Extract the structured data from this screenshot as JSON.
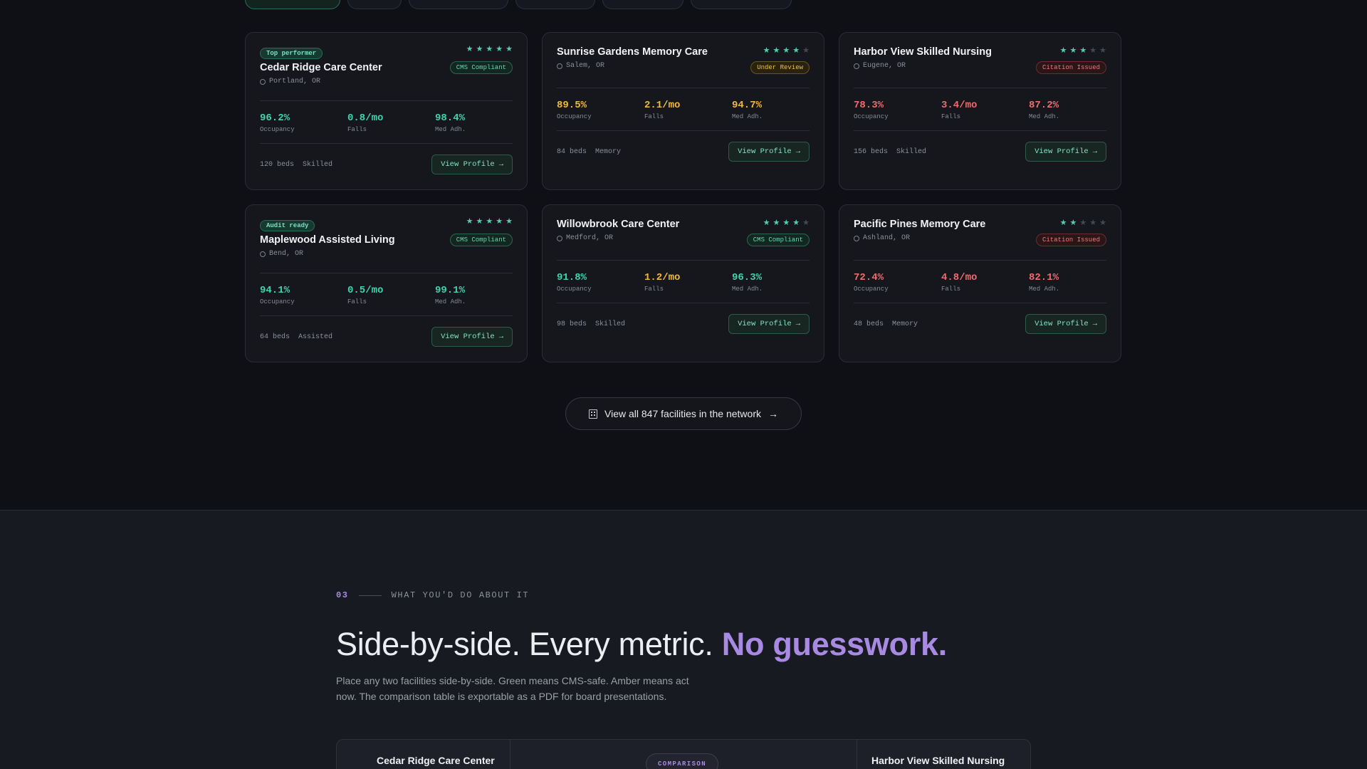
{
  "facilities": [
    {
      "tag": "Top performer",
      "name": "Cedar Ridge Care Center",
      "location": "Portland, OR",
      "rating": 5,
      "status": "CMS Compliant",
      "status_tone": "green",
      "occupancy": "96.2%",
      "occupancy_tone": "g",
      "falls": "0.8/mo",
      "falls_tone": "g",
      "med": "98.4%",
      "med_tone": "g",
      "beds": "120 beds",
      "type": "Skilled"
    },
    {
      "tag": "",
      "name": "Sunrise Gardens Memory Care",
      "location": "Salem, OR",
      "rating": 4,
      "status": "Under Review",
      "status_tone": "amber",
      "occupancy": "89.5%",
      "occupancy_tone": "a",
      "falls": "2.1/mo",
      "falls_tone": "a",
      "med": "94.7%",
      "med_tone": "a",
      "beds": "84 beds",
      "type": "Memory"
    },
    {
      "tag": "",
      "name": "Harbor View Skilled Nursing",
      "location": "Eugene, OR",
      "rating": 3,
      "status": "Citation Issued",
      "status_tone": "red",
      "occupancy": "78.3%",
      "occupancy_tone": "r",
      "falls": "3.4/mo",
      "falls_tone": "r",
      "med": "87.2%",
      "med_tone": "r",
      "beds": "156 beds",
      "type": "Skilled"
    },
    {
      "tag": "Audit ready",
      "name": "Maplewood Assisted Living",
      "location": "Bend, OR",
      "rating": 5,
      "status": "CMS Compliant",
      "status_tone": "green",
      "occupancy": "94.1%",
      "occupancy_tone": "g",
      "falls": "0.5/mo",
      "falls_tone": "g",
      "med": "99.1%",
      "med_tone": "g",
      "beds": "64 beds",
      "type": "Assisted"
    },
    {
      "tag": "",
      "name": "Willowbrook Care Center",
      "location": "Medford, OR",
      "rating": 4,
      "status": "CMS Compliant",
      "status_tone": "green",
      "occupancy": "91.8%",
      "occupancy_tone": "g",
      "falls": "1.2/mo",
      "falls_tone": "a",
      "med": "96.3%",
      "med_tone": "g",
      "beds": "98 beds",
      "type": "Skilled"
    },
    {
      "tag": "",
      "name": "Pacific Pines Memory Care",
      "location": "Ashland, OR",
      "rating": 2,
      "status": "Citation Issued",
      "status_tone": "red",
      "occupancy": "72.4%",
      "occupancy_tone": "r",
      "falls": "4.8/mo",
      "falls_tone": "r",
      "med": "82.1%",
      "med_tone": "r",
      "beds": "48 beds",
      "type": "Memory"
    }
  ],
  "labels": {
    "occupancy": "Occupancy",
    "falls": "Falls",
    "med": "Med Adh.",
    "view_profile": "View Profile"
  },
  "view_all": "View all 847 facilities in the network",
  "section": {
    "number": "03",
    "eyebrow": "WHAT YOU'D DO ABOUT IT",
    "headline_main": "Side-by-side. Every metric. ",
    "headline_accent": "No guesswork.",
    "lede": "Place any two facilities side-by-side. Green means CMS-safe. Amber means act now. The comparison table is exportable as a PDF for board presentations."
  },
  "comparison": {
    "left": "Cedar Ridge Care Center",
    "pill": "COMPARISON",
    "right": "Harbor View Skilled Nursing"
  },
  "colors": {
    "accent_green": "#3fd4ac",
    "accent_amber": "#f0b93a",
    "accent_red": "#f06b6b",
    "accent_purple": "#a98ae3"
  }
}
